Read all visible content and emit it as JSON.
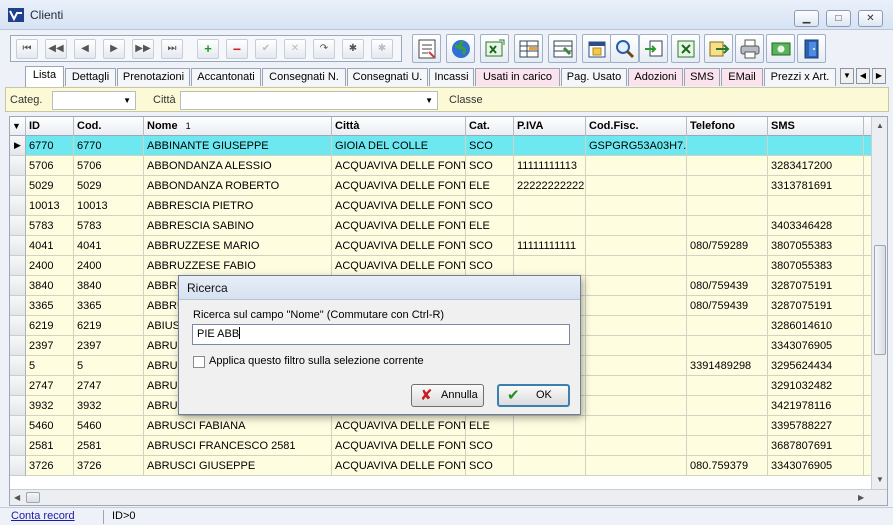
{
  "window": {
    "title": "Clienti",
    "minimize": "▁",
    "maximize": "□",
    "close": "✕"
  },
  "toolbar": {
    "nav_buttons": [
      "⏮",
      "◀◀",
      "◀",
      "▶",
      "▶▶",
      "⏭",
      "+",
      "−",
      "✔",
      "✕",
      "↷",
      "✱",
      "✱"
    ],
    "icon_buttons": [
      "form-icon",
      "globe-icon",
      "excel-export-icon",
      "grid-settings-icon",
      "grid-columns-icon",
      "calendar-icon",
      "magnifier-icon",
      "import-icon",
      "excel-icon",
      "export-arrow-icon",
      "printer-icon",
      "money-icon",
      "exit-door-icon"
    ]
  },
  "tabs": {
    "items": [
      {
        "label": "Lista",
        "active": true,
        "pink": false
      },
      {
        "label": "Dettagli",
        "active": false,
        "pink": false
      },
      {
        "label": "Prenotazioni",
        "active": false,
        "pink": false
      },
      {
        "label": "Accantonati",
        "active": false,
        "pink": false
      },
      {
        "label": "Consegnati N.",
        "active": false,
        "pink": false
      },
      {
        "label": "Consegnati U.",
        "active": false,
        "pink": false
      },
      {
        "label": "Incassi",
        "active": false,
        "pink": false
      },
      {
        "label": "Usati in carico",
        "active": false,
        "pink": true
      },
      {
        "label": "Pag. Usato",
        "active": false,
        "pink": false
      },
      {
        "label": "Adozioni",
        "active": false,
        "pink": true
      },
      {
        "label": "SMS",
        "active": false,
        "pink": true
      },
      {
        "label": "EMail",
        "active": false,
        "pink": true
      },
      {
        "label": "Prezzi x Art.",
        "active": false,
        "pink": false
      }
    ]
  },
  "filters": {
    "categ_label": "Categ.",
    "categ_value": "",
    "citta_label": "Città",
    "citta_value": "",
    "classe_label": "Classe"
  },
  "grid": {
    "columns": [
      "ID",
      "Cod.",
      "Nome",
      "Città",
      "Cat.",
      "P.IVA",
      "Cod.Fisc.",
      "Telefono",
      "SMS"
    ],
    "sort_indicator": "1",
    "rows": [
      [
        "6770",
        "6770",
        "ABBINANTE GIUSEPPE",
        "GIOIA DEL COLLE",
        "SCO",
        "",
        "GSPGRG53A03H7...",
        "",
        ""
      ],
      [
        "5706",
        "5706",
        "ABBONDANZA ALESSIO",
        "ACQUAVIVA DELLE FONTI",
        "SCO",
        "11111111113",
        "",
        "",
        "3283417200"
      ],
      [
        "5029",
        "5029",
        "ABBONDANZA ROBERTO",
        "ACQUAVIVA DELLE FONTI",
        "ELE",
        "22222222222",
        "",
        "",
        "3313781691"
      ],
      [
        "10013",
        "10013",
        "ABBRESCIA PIETRO",
        "ACQUAVIVA DELLE FONTI",
        "SCO",
        "",
        "",
        "",
        ""
      ],
      [
        "5783",
        "5783",
        "ABBRESCIA SABINO",
        "ACQUAVIVA DELLE FONTI",
        "ELE",
        "",
        "",
        "",
        "3403346428"
      ],
      [
        "4041",
        "4041",
        "ABBRUZZESE  MARIO",
        "ACQUAVIVA DELLE FONTI",
        "SCO",
        "11111111111",
        "",
        "080/759289",
        "3807055383"
      ],
      [
        "2400",
        "2400",
        "ABBRUZZESE FABIO",
        "ACQUAVIVA DELLE FONTI",
        "SCO",
        "",
        "",
        "",
        "3807055383"
      ],
      [
        "3840",
        "3840",
        "ABBRU",
        "",
        "",
        "",
        "",
        "080/759439",
        "3287075191"
      ],
      [
        "3365",
        "3365",
        "ABBRU",
        "",
        "",
        "",
        "",
        "080/759439",
        "3287075191"
      ],
      [
        "6219",
        "6219",
        "ABIUSI",
        "",
        "",
        "",
        "",
        "",
        "3286014610"
      ],
      [
        "2397",
        "2397",
        "ABRUS",
        "",
        "",
        "",
        "",
        "",
        "3343076905"
      ],
      [
        "5",
        "5",
        "ABRUS",
        "",
        "",
        "",
        "",
        "3391489298",
        "3295624434"
      ],
      [
        "2747",
        "2747",
        "ABRUS",
        "",
        "",
        "",
        "",
        "",
        "3291032482"
      ],
      [
        "3932",
        "3932",
        "ABRUS",
        "",
        "",
        "",
        "",
        "",
        "3421978116"
      ],
      [
        "5460",
        "5460",
        "ABRUSCI FABIANA",
        "ACQUAVIVA DELLE FONTI",
        "ELE",
        "",
        "",
        "",
        "3395788227"
      ],
      [
        "2581",
        "2581",
        "ABRUSCI FRANCESCO 2581",
        "ACQUAVIVA DELLE FONTI",
        "SCO",
        "",
        "",
        "",
        "3687807691"
      ],
      [
        "3726",
        "3726",
        "ABRUSCI GIUSEPPE",
        "ACQUAVIVA DELLE FONTI",
        "SCO",
        "",
        "",
        "080.759379",
        "3343076905"
      ]
    ]
  },
  "status": {
    "link": "Conta record",
    "id_text": "ID>0"
  },
  "dialog": {
    "title": "Ricerca",
    "label": "Ricerca sul campo \"Nome\"  (Commutare con Ctrl-R)",
    "value": "PIE ABB",
    "checkbox_label": "Applica questo filtro sulla selezione corrente",
    "cancel_label": "Annulla",
    "ok_label": "OK"
  }
}
